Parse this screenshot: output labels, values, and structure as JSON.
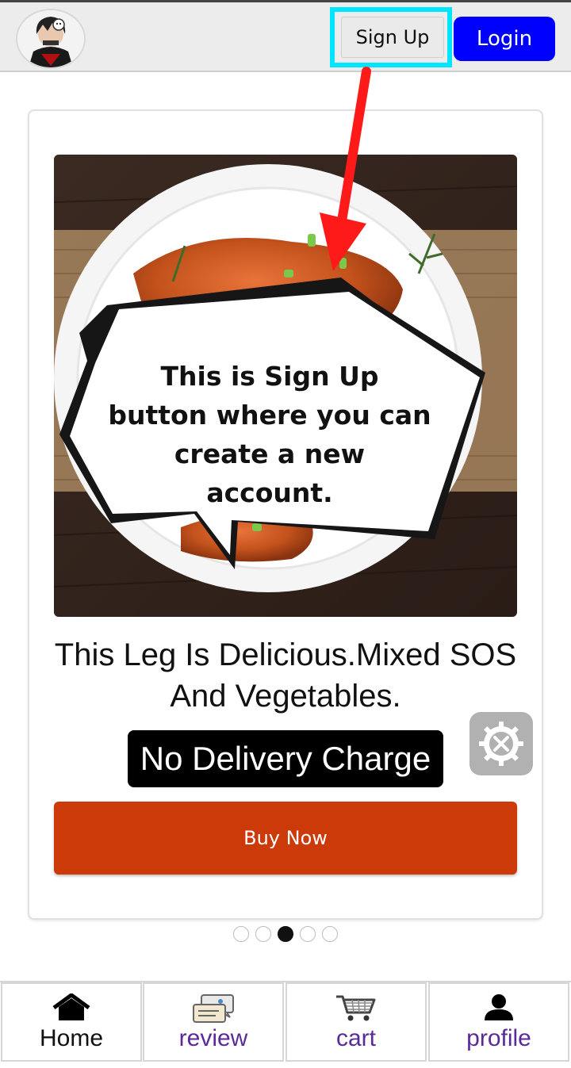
{
  "header": {
    "avatar_icon": "user-avatar-icon",
    "signup_label": "Sign Up",
    "login_label": "Login",
    "login_color": "#0000ff",
    "highlight_color": "#00e5ff"
  },
  "annotation": {
    "text": "This is Sign Up button where you can create a new account.",
    "arrow_color": "#ff1a1a"
  },
  "product": {
    "image": "roasted-chicken-leg-plate-image",
    "caption": "This Leg Is Delicious.Mixed SOS And Vegetables.",
    "badge": "No Delivery Charge",
    "buy_label": "Buy Now",
    "buy_color": "#cc3a0a"
  },
  "carousel": {
    "count": 5,
    "active_index": 2
  },
  "settings_icon": "settings-tools-icon",
  "nav": {
    "items": [
      {
        "label": "Home",
        "icon": "home-icon",
        "color": "#111111"
      },
      {
        "label": "review",
        "icon": "chat-bubbles-icon",
        "color": "#5b2a9a"
      },
      {
        "label": "cart",
        "icon": "shopping-cart-icon",
        "color": "#5b2a9a"
      },
      {
        "label": "profile",
        "icon": "person-icon",
        "color": "#5b2a9a"
      }
    ]
  }
}
